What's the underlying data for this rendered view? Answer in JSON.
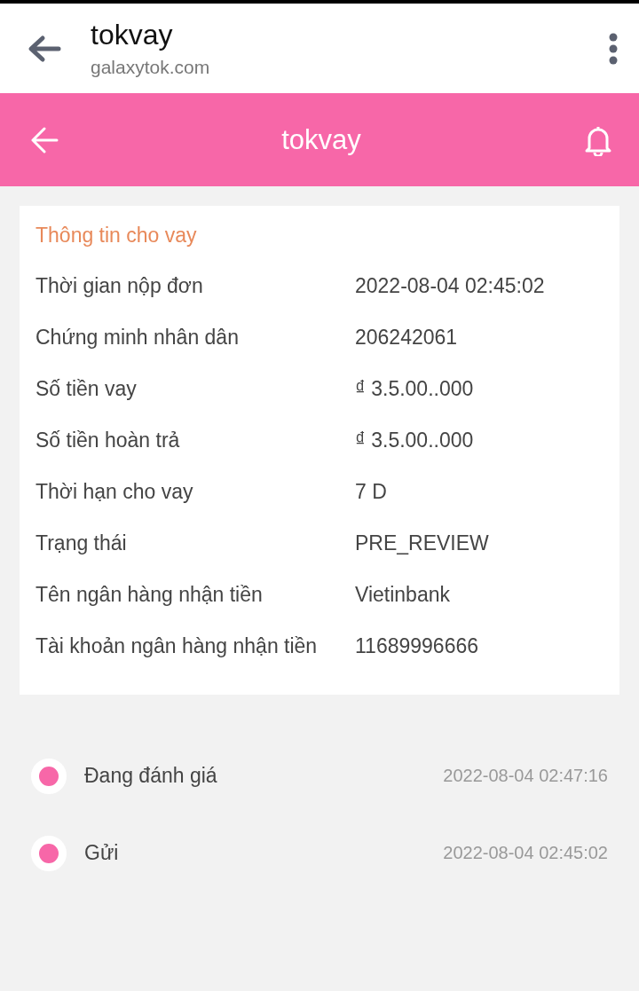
{
  "browser_bar": {
    "title": "tokvay",
    "url": "galaxytok.com"
  },
  "app_bar": {
    "title": "tokvay"
  },
  "loan_info": {
    "heading": "Thông tin cho vay",
    "rows": [
      {
        "label": "Thời gian nộp đơn",
        "value": "2022-08-04 02:45:02"
      },
      {
        "label": "Chứng minh nhân dân",
        "value": "206242061"
      },
      {
        "label": "Số tiền vay",
        "value": "₫ 3.5.00..000"
      },
      {
        "label": "Số tiền hoàn trả",
        "value": "₫ 3.5.00..000"
      },
      {
        "label": "Thời hạn cho vay",
        "value": "7 D"
      },
      {
        "label": "Trạng thái",
        "value": "PRE_REVIEW"
      },
      {
        "label": "Tên ngân hàng nhận tiền",
        "value": "Vietinbank"
      },
      {
        "label": "Tài khoản ngân hàng nhận tiền",
        "value": "11689996666"
      }
    ]
  },
  "timeline": [
    {
      "status": "Đang đánh giá",
      "time": "2022-08-04 02:47:16"
    },
    {
      "status": "Gửi",
      "time": "2022-08-04 02:45:02"
    }
  ]
}
